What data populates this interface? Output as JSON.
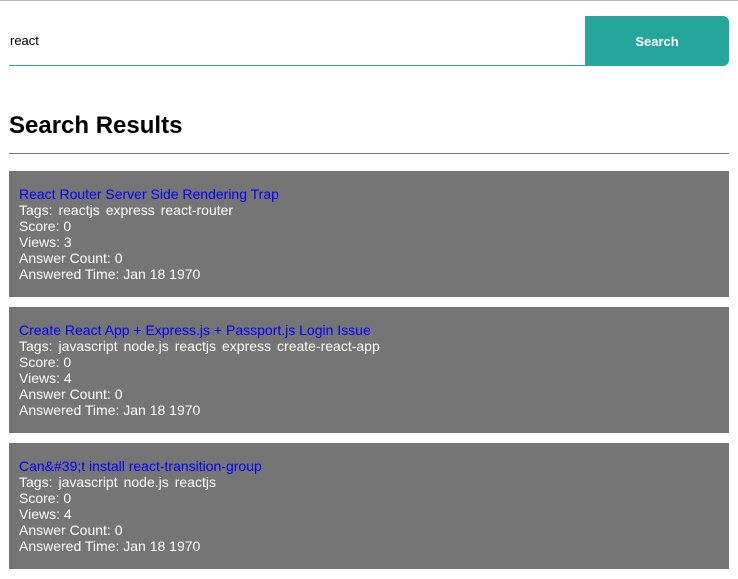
{
  "search": {
    "value": "react",
    "button_label": "Search"
  },
  "heading": "Search Results",
  "results": [
    {
      "title": "React Router Server Side Rendering Trap",
      "tags_label": "Tags:",
      "tags": [
        "reactjs",
        "express",
        "react-router"
      ],
      "score": "Score: 0",
      "views": "Views: 3",
      "answer_count": "Answer Count: 0",
      "answered_time": "Answered Time: Jan 18 1970"
    },
    {
      "title": "Create React App + Express.js + Passport.js Login Issue",
      "tags_label": "Tags:",
      "tags": [
        "javascript",
        "node.js",
        "reactjs",
        "express",
        "create-react-app"
      ],
      "score": "Score: 0",
      "views": "Views: 4",
      "answer_count": "Answer Count: 0",
      "answered_time": "Answered Time: Jan 18 1970"
    },
    {
      "title": "Can&#39;t install react-transition-group",
      "tags_label": "Tags:",
      "tags": [
        "javascript",
        "node.js",
        "reactjs"
      ],
      "score": "Score: 0",
      "views": "Views: 4",
      "answer_count": "Answer Count: 0",
      "answered_time": "Answered Time: Jan 18 1970"
    }
  ]
}
